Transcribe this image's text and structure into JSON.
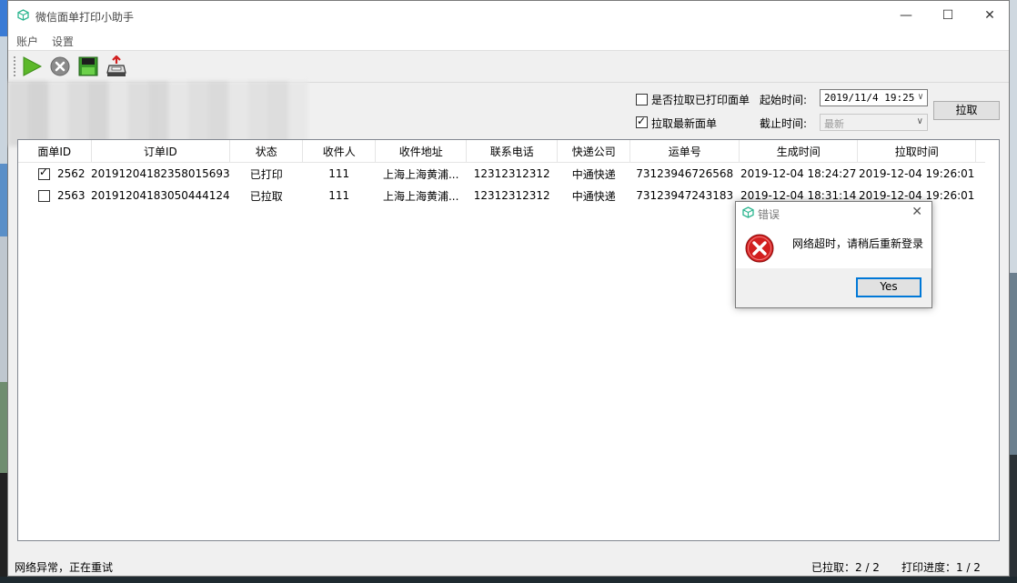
{
  "window": {
    "title": "微信面单打印小助手"
  },
  "menu": [
    "账户",
    "设置"
  ],
  "filters": {
    "include_printed_label": "是否拉取已打印面单",
    "include_printed_checked": false,
    "pull_latest_label": "拉取最新面单",
    "pull_latest_checked": true,
    "start_time_label": "起始时间:",
    "start_time_value": "2019/11/4 19:25",
    "end_time_label": "截止时间:",
    "end_time_value": "最新",
    "pull_button": "拉取"
  },
  "table": {
    "columns": [
      "面单ID",
      "订单ID",
      "状态",
      "收件人",
      "收件地址",
      "联系电话",
      "快递公司",
      "运单号",
      "生成时间",
      "拉取时间"
    ],
    "rows": [
      {
        "checked": true,
        "id": "2562",
        "order_id": "20191204182358015693",
        "status": "已打印",
        "recipient": "111",
        "address": "上海上海黄浦...",
        "phone": "12312312312",
        "courier": "中通快递",
        "tracking": "73123946726568",
        "created": "2019-12-04 18:24:27",
        "pulled": "2019-12-04 19:26:01"
      },
      {
        "checked": false,
        "id": "2563",
        "order_id": "20191204183050444124",
        "status": "已拉取",
        "recipient": "111",
        "address": "上海上海黄浦...",
        "phone": "12312312312",
        "courier": "中通快递",
        "tracking": "73123947243183",
        "created": "2019-12-04 18:31:14",
        "pulled": "2019-12-04 19:26:01"
      }
    ]
  },
  "status": {
    "message": "网络异常，正在重试",
    "pulled": "已拉取：2 / 2",
    "progress": "打印进度：1 / 2"
  },
  "dialog": {
    "title": "错误",
    "message": "网络超时，请稍后重新登录",
    "yes": "Yes"
  },
  "colors": {
    "play": "#5cb82a",
    "error_red": "#d21f1f",
    "accent": "#0078d7"
  }
}
